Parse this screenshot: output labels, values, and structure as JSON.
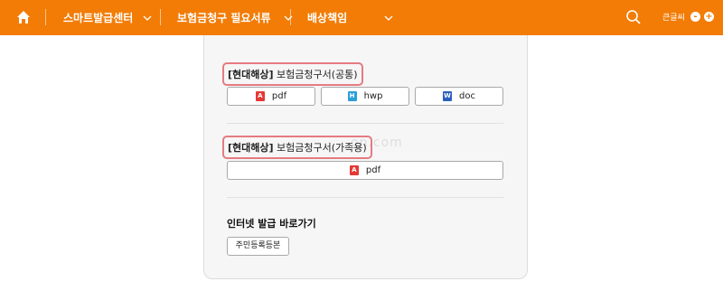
{
  "nav": {
    "items": [
      {
        "label": "스마트발급센터"
      },
      {
        "label": "보험금청구 필요서류"
      },
      {
        "label": "배상책임"
      }
    ],
    "font_size_label": "큰글씨",
    "font_decrease": "-",
    "font_increase": "+"
  },
  "sections": [
    {
      "title_bold": "[현대해상]",
      "title_rest": " 보험금청구서(공통)",
      "buttons": [
        {
          "label": "pdf",
          "icon": "pdf-icon"
        },
        {
          "label": "hwp",
          "icon": "hwp-icon"
        },
        {
          "label": "doc",
          "icon": "doc-icon"
        }
      ]
    },
    {
      "title_bold": "[현대해상]",
      "title_rest": " 보험금청구서(가족용)",
      "buttons": [
        {
          "label": "pdf",
          "icon": "pdf-icon"
        }
      ]
    }
  ],
  "internet": {
    "title": "인터넷 발급 바로가기",
    "button": "주민등록등본"
  },
  "watermark": "on.com",
  "colors": {
    "brand_orange": "#f27c06",
    "highlight_border": "#e57b82",
    "pdf_red": "#e53935",
    "hwp_blue": "#2a9fd8",
    "doc_blue": "#2b5fbd"
  }
}
